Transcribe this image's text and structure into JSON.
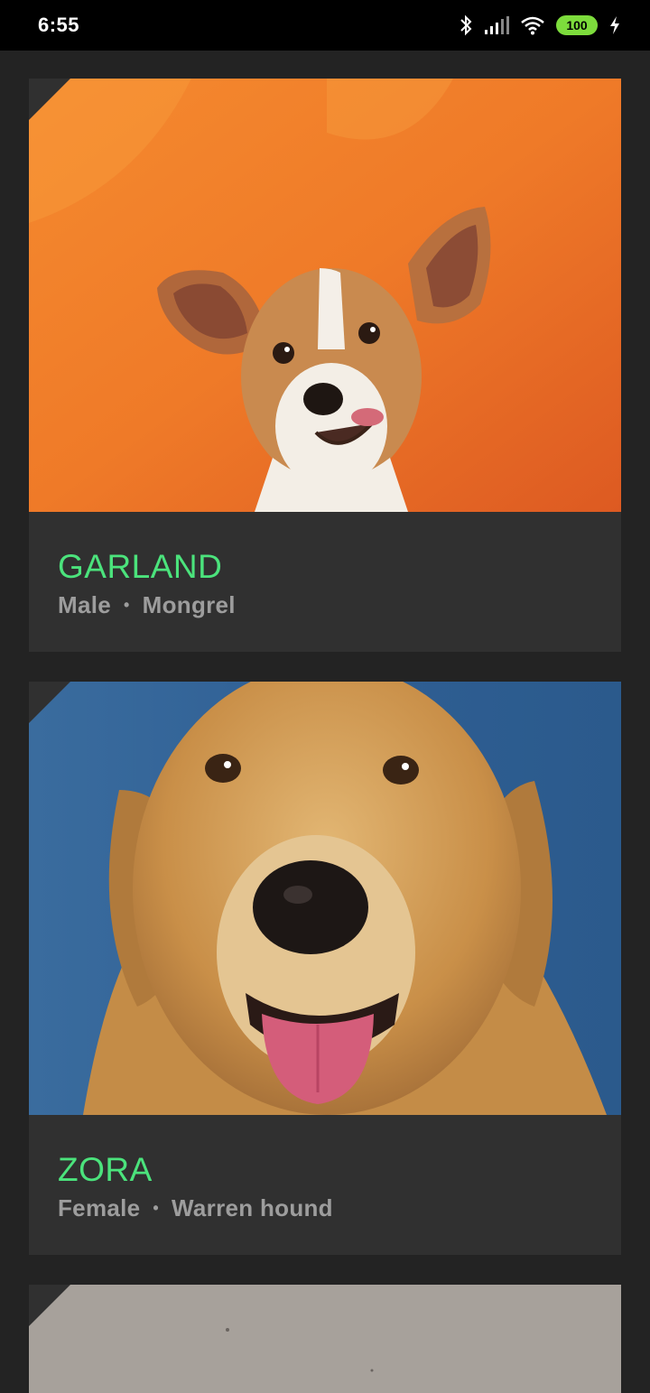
{
  "status_bar": {
    "time": "6:55",
    "battery": "100",
    "icons": [
      "bluetooth-icon",
      "signal-icon",
      "wifi-icon",
      "battery-icon",
      "charging-icon"
    ]
  },
  "dogs": [
    {
      "name": "GARLAND",
      "gender": "Male",
      "separator": "•",
      "breed": "Mongrel",
      "photo_bg": "#ee7a2a"
    },
    {
      "name": "ZORA",
      "gender": "Female",
      "separator": "•",
      "breed": "Warren hound",
      "photo_bg": "#2f5f94"
    }
  ],
  "colors": {
    "accent": "#4be37c",
    "card": "#303030",
    "background": "#232323",
    "meta_text": "#9d9d9d"
  }
}
